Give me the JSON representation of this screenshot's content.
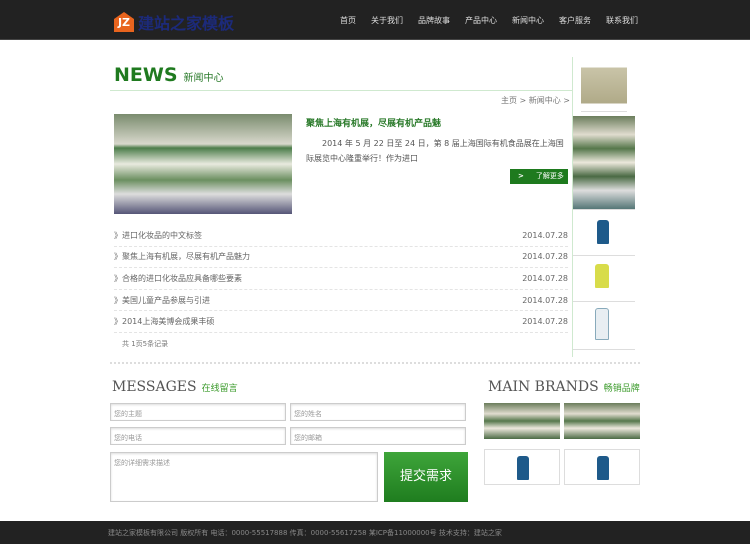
{
  "header": {
    "logo_mark": "JZ",
    "logo_text": "建站之家模板",
    "nav": [
      "首页",
      "关于我们",
      "品牌故事",
      "产品中心",
      "新闻中心",
      "客户服务",
      "联系我们"
    ]
  },
  "news": {
    "title_en": "NEWS",
    "title_cn": "新闻中心",
    "breadcrumb": "主页 > 新闻中心 >",
    "featured": {
      "title": "聚焦上海有机展，尽展有机产品魅",
      "text": "2014 年 5 月 22 日至 24 日，第 8 届上海国际有机食品展在上海国际展览中心隆重举行！作为进口",
      "more": "了解更多",
      "more_icon": "chevron-right"
    },
    "items": [
      {
        "title": "进口化妆品的中文标签",
        "date": "2014.07.28"
      },
      {
        "title": "聚焦上海有机展，尽展有机产品魅力",
        "date": "2014.07.28"
      },
      {
        "title": "合格的进口化妆品应具备哪些要素",
        "date": "2014.07.28"
      },
      {
        "title": "美国儿童产品参展与引进",
        "date": "2014.07.28"
      },
      {
        "title": "2014上海美博会成果丰硕",
        "date": "2014.07.28"
      }
    ],
    "pager": "共 1页5条记录"
  },
  "messages": {
    "title_en": "MESSAGES",
    "title_cn": "在线留言",
    "subject": "您的主题",
    "name": "您的姓名",
    "phone": "您的电话",
    "email": "您的邮箱",
    "detail": "您的详细需求描述",
    "submit": "提交需求"
  },
  "brands": {
    "title_en": "MAIN BRANDS",
    "title_cn": "畅销品牌"
  },
  "footer": {
    "text": "建站之家模板有限公司 版权所有 电话：0000-55517888 传真：0000-55617258 某ICP备11000000号 技术支持：建站之家"
  }
}
